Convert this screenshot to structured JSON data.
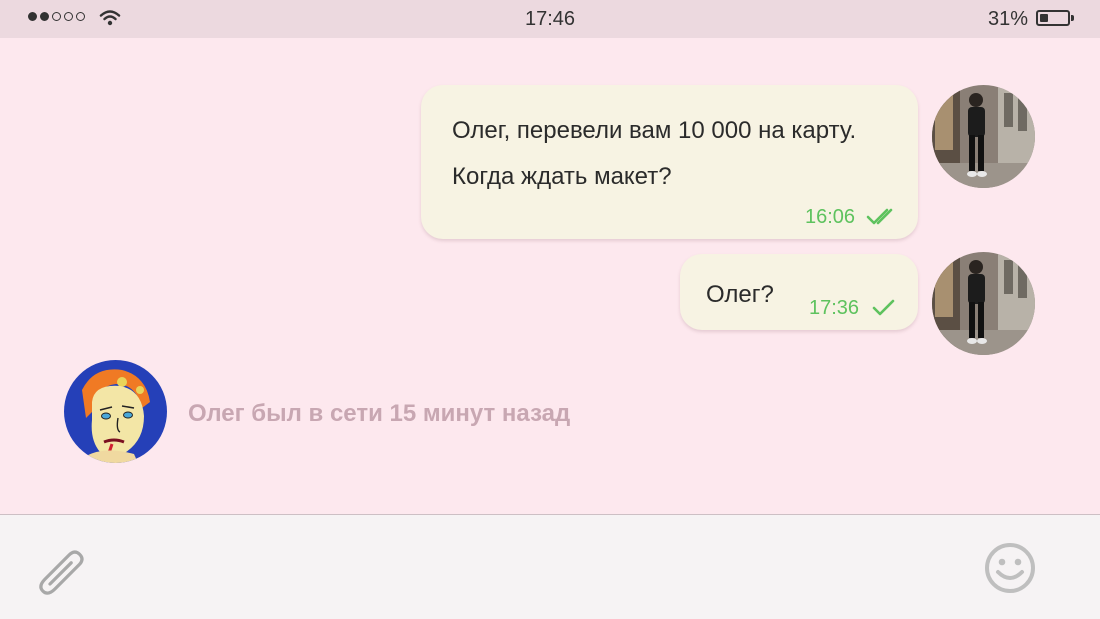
{
  "status_bar": {
    "signal_dots": 5,
    "signal_filled": 2,
    "time": "17:46",
    "battery_percent": "31%",
    "battery_level": 0.31
  },
  "messages": [
    {
      "lines": [
        "Олег, перевели вам 10 000 на карту.",
        "Когда ждать макет?"
      ],
      "time": "16:06",
      "status": "double-check-icon"
    },
    {
      "lines": [
        "Олег?"
      ],
      "time": "17:36",
      "status": "check-icon"
    }
  ],
  "contact": {
    "presence": "Олег был в сети 15 минут назад"
  },
  "input_bar": {
    "attach_icon": "paperclip-icon",
    "emoji_icon": "smiley-icon"
  },
  "colors": {
    "chat_background": "#fde8ee",
    "bubble": "#f7f3e3",
    "timestamp": "#5ec25e",
    "presence_text": "#c8a7b2"
  }
}
